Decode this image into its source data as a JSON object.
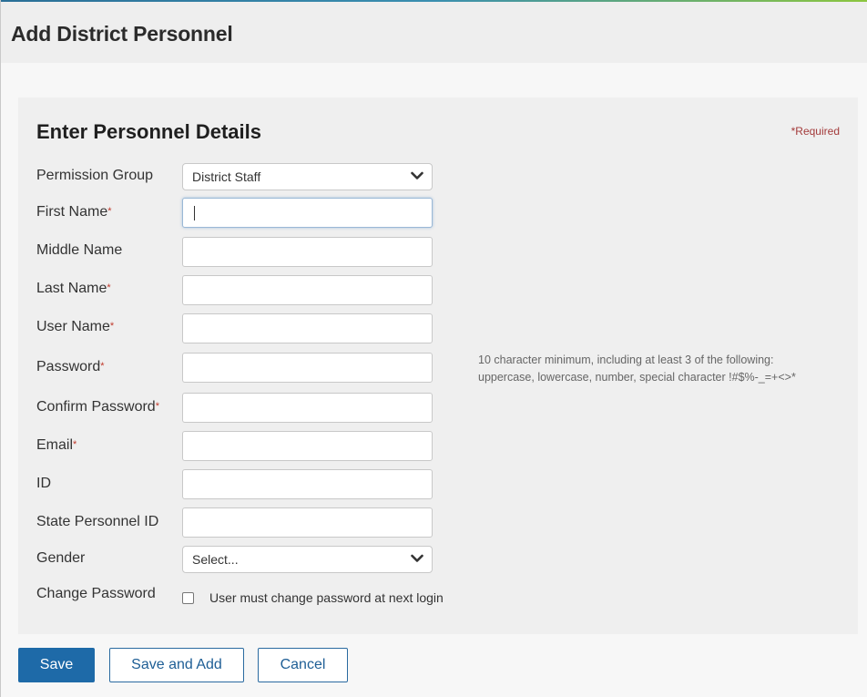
{
  "header": {
    "title": "Add District Personnel"
  },
  "form": {
    "section_title": "Enter Personnel Details",
    "required_star": "*",
    "required_label": "Required",
    "fields": {
      "permission_group": {
        "label": "Permission Group",
        "value": "District Staff"
      },
      "first_name": {
        "label": "First Name",
        "value": ""
      },
      "middle_name": {
        "label": "Middle Name",
        "value": ""
      },
      "last_name": {
        "label": "Last Name",
        "value": ""
      },
      "user_name": {
        "label": "User Name",
        "value": ""
      },
      "password": {
        "label": "Password",
        "value": ""
      },
      "confirm_password": {
        "label": "Confirm Password",
        "value": ""
      },
      "email": {
        "label": "Email",
        "value": ""
      },
      "id": {
        "label": "ID",
        "value": ""
      },
      "state_personnel_id": {
        "label": "State Personnel ID",
        "value": ""
      },
      "gender": {
        "label": "Gender",
        "value": "Select..."
      },
      "change_password": {
        "label": "Change Password",
        "checkbox_label": "User must change password at next login",
        "checked": false
      }
    },
    "password_hint_line1": "10 character minimum, including at least 3 of the following:",
    "password_hint_line2": "uppercase, lowercase, number, special character !#$%-_=+<>*"
  },
  "buttons": {
    "save": "Save",
    "save_and_add": "Save and Add",
    "cancel": "Cancel"
  },
  "colors": {
    "primary": "#1e6aa8",
    "required": "#c0392b"
  }
}
